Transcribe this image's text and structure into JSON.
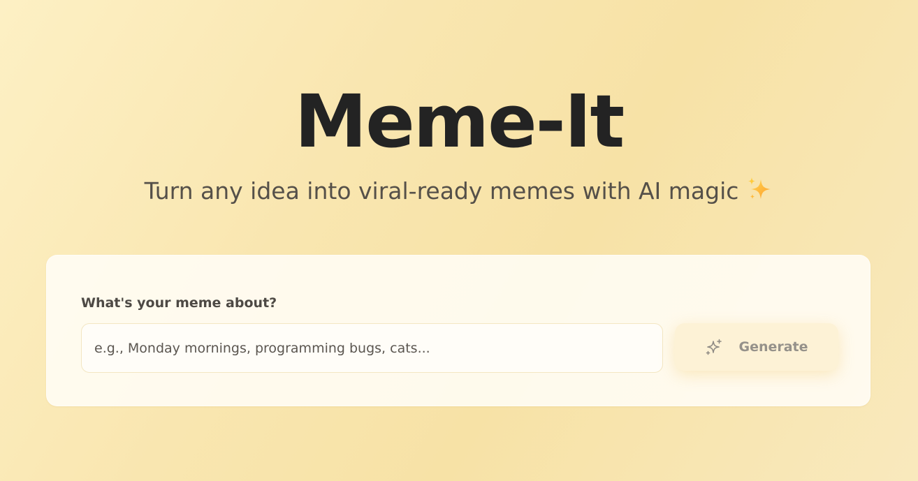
{
  "hero": {
    "title": "Meme-It",
    "subtitle": "Turn any idea into viral-ready memes with AI magic",
    "subtitle_emoji": "sparkles-emoji"
  },
  "form": {
    "label": "What's your meme about?",
    "input_value": "",
    "input_placeholder": "e.g., Monday mornings, programming bugs, cats...",
    "button_label": "Generate",
    "button_icon": "sparkles-icon"
  },
  "colors": {
    "background": "#f9e6b0",
    "card": "#fffdf6",
    "title": "#232323",
    "subtitle": "#555049",
    "button_background": "#fdf2d6",
    "button_text": "#95918a"
  }
}
